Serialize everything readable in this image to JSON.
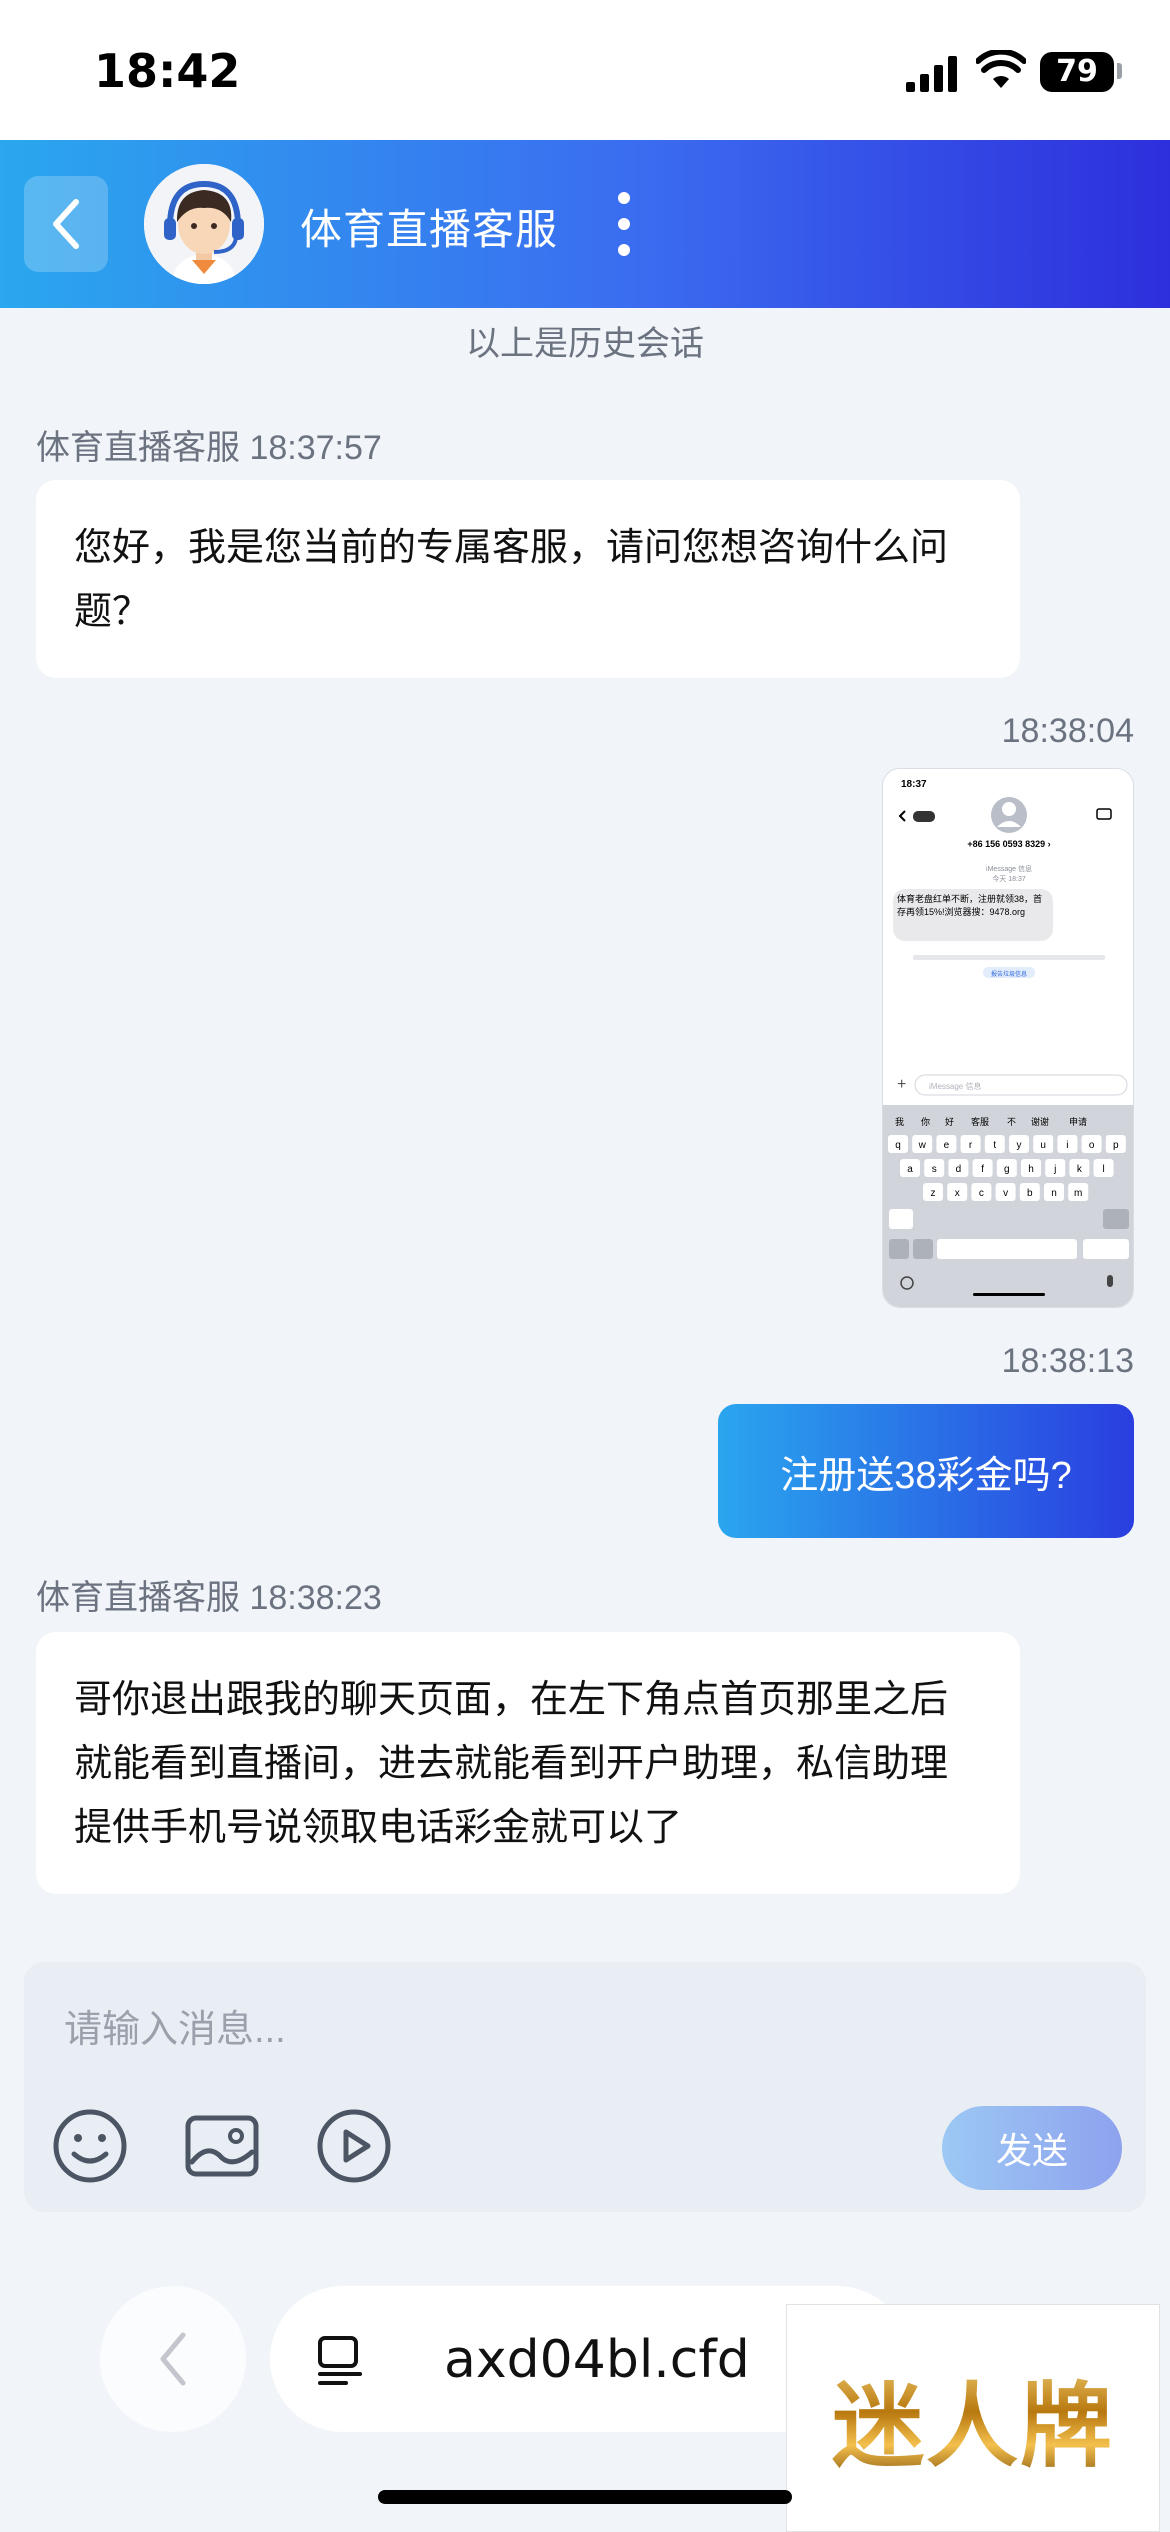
{
  "status_bar": {
    "time": "18:42",
    "battery": "79"
  },
  "header": {
    "title": "体育直播客服"
  },
  "chat": {
    "history_note": "以上是历史会话",
    "messages": [
      {
        "sender": "体育直播客服",
        "time": "18:37:57",
        "text": "您好，我是您当前的专属客服，请问您想咨询什么问题？"
      },
      {
        "time": "18:38:04",
        "type": "image"
      },
      {
        "time": "18:38:13",
        "text": "注册送38彩金吗?"
      },
      {
        "sender": "体育直播客服",
        "time": "18:38:23",
        "text": "哥你退出跟我的聊天页面，在左下角点首页那里之后就能看到直播间，进去就能看到开户助理，私信助理提供手机号说领取电话彩金就可以了"
      }
    ],
    "screenshot": {
      "time": "18:37",
      "contact": "+86 156 0593 8329 ›",
      "label": "iMessage 信息",
      "sub": "今天 18:37",
      "sms": "体育老盘红单不断，注册就领38，首存再领15%!浏览器搜：9478.org",
      "report_link": "报告垃圾信息",
      "input_placeholder": "iMessage 信息",
      "suggestions": [
        "我",
        "你",
        "好",
        "客服",
        "不",
        "谢谢",
        "申请"
      ],
      "keys_row1": [
        "q",
        "w",
        "e",
        "r",
        "t",
        "y",
        "u",
        "i",
        "o",
        "p"
      ],
      "keys_row2": [
        "a",
        "s",
        "d",
        "f",
        "g",
        "h",
        "j",
        "k",
        "l"
      ],
      "keys_row3": [
        "z",
        "x",
        "c",
        "v",
        "b",
        "n",
        "m"
      ]
    }
  },
  "composer": {
    "placeholder": "请输入消息...",
    "send_label": "发送"
  },
  "browser": {
    "url": "axd04bl.cfd"
  },
  "watermark": {
    "text": "迷人牌"
  }
}
